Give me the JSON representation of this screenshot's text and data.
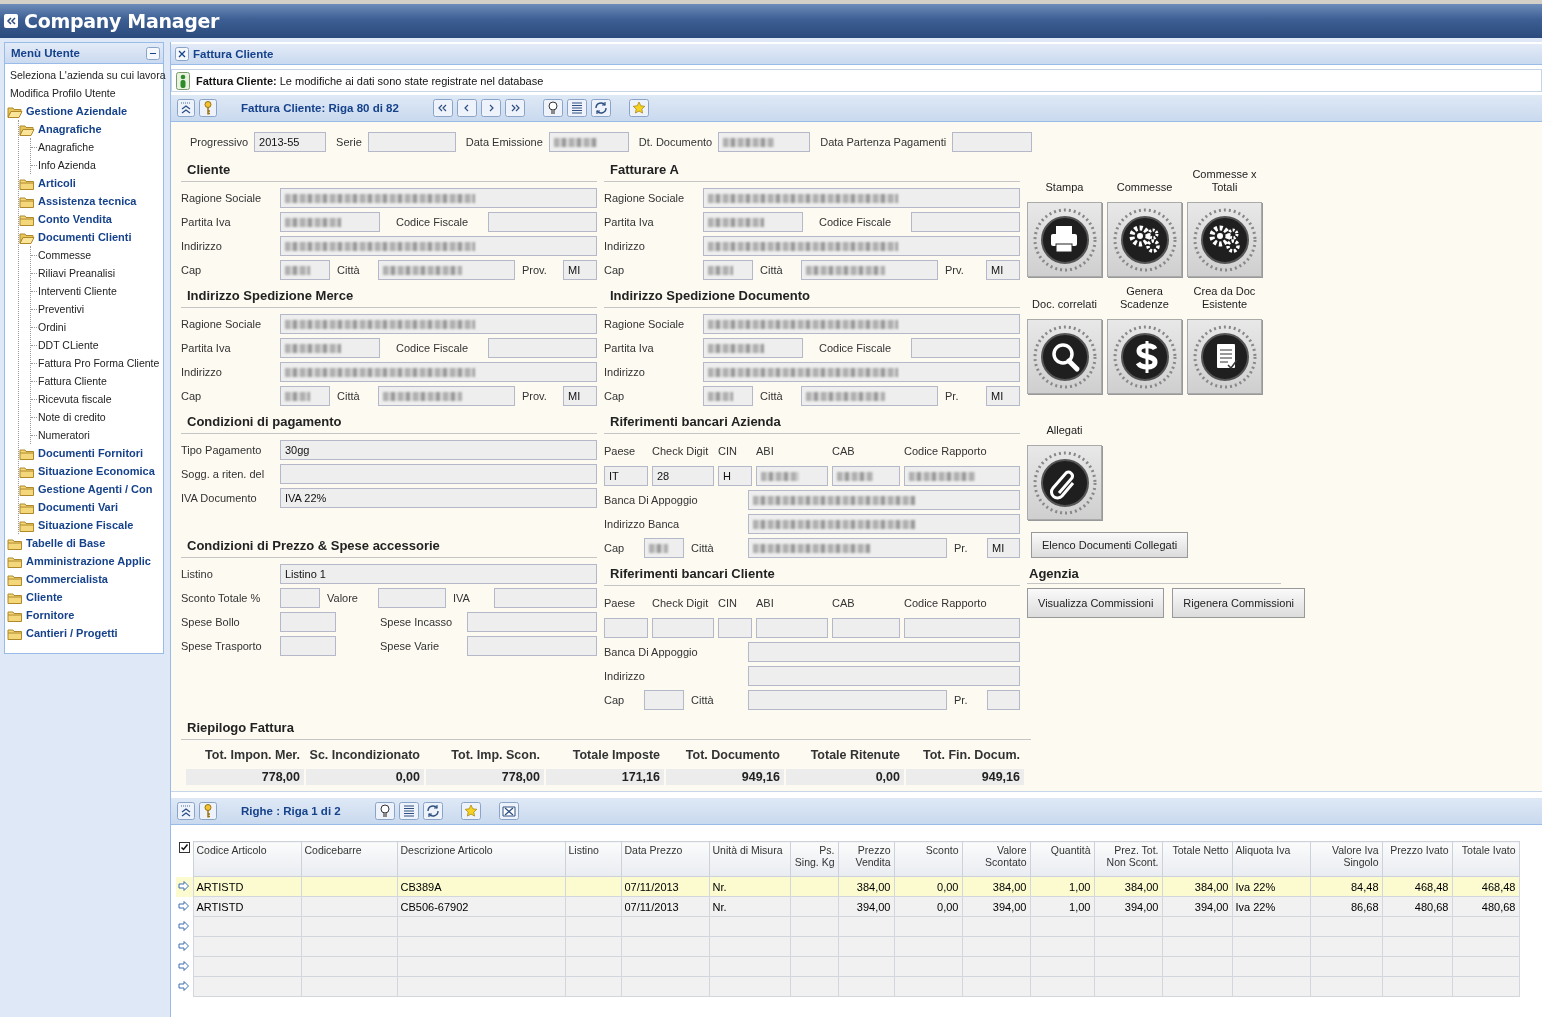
{
  "app_title": "Company Manager",
  "sidebar": {
    "title": "Menù Utente",
    "links": [
      "Seleziona L'azienda su cui lavora",
      "Modifica Profilo Utente"
    ],
    "tree": [
      {
        "label": "Gestione Aziendale",
        "expanded": true,
        "children": [
          {
            "label": "Anagrafiche",
            "expanded": true,
            "children": [
              {
                "label": "Anagrafiche"
              },
              {
                "label": "Info Azienda"
              }
            ]
          },
          {
            "label": "Articoli",
            "expanded": false
          },
          {
            "label": "Assistenza tecnica",
            "expanded": false
          },
          {
            "label": "Conto Vendita",
            "expanded": false
          },
          {
            "label": "Documenti Clienti",
            "expanded": true,
            "children": [
              {
                "label": "Commesse"
              },
              {
                "label": "Riliavi Preanalisi"
              },
              {
                "label": "Interventi Cliente"
              },
              {
                "label": "Preventivi"
              },
              {
                "label": "Ordini"
              },
              {
                "label": "DDT CLiente"
              },
              {
                "label": "Fattura Pro Forma Cliente"
              },
              {
                "label": "Fattura Cliente"
              },
              {
                "label": "Ricevuta fiscale"
              },
              {
                "label": "Note di credito"
              },
              {
                "label": "Numeratori"
              }
            ]
          },
          {
            "label": "Documenti Fornitori",
            "expanded": false
          },
          {
            "label": "Situazione Economica",
            "expanded": false
          },
          {
            "label": "Gestione Agenti / Con",
            "expanded": false
          },
          {
            "label": "Documenti Vari",
            "expanded": false
          },
          {
            "label": "Situazione Fiscale",
            "expanded": false
          }
        ]
      },
      {
        "label": "Tabelle di Base",
        "expanded": false
      },
      {
        "label": "Amministrazione Applic",
        "expanded": false
      },
      {
        "label": "Commercialista",
        "expanded": false
      },
      {
        "label": "Cliente",
        "expanded": false
      },
      {
        "label": "Fornitore",
        "expanded": false
      },
      {
        "label": "Cantieri / Progetti",
        "expanded": false
      }
    ]
  },
  "panel": {
    "title": "Fattura Cliente",
    "message": "**Fattura Cliente:** Le modifiche ai dati sono state registrate nel database",
    "toolbar": {
      "caption": "Fattura Cliente: Riga 80 di 82",
      "navigation": true,
      "export": false
    }
  },
  "form": {
    "header_fields": [
      {
        "label": "Progressivo",
        "value": "2013-55",
        "redacted": false
      },
      {
        "label": "Serie",
        "redacted": false
      },
      {
        "label": "Data Emissione",
        "redacted": true
      },
      {
        "label": "Dt. Documento",
        "redacted": true
      },
      {
        "label": "Data Partenza Pagamenti",
        "redacted": false
      }
    ],
    "left": [
      {
        "title": "Cliente",
        "kind": "address",
        "rows": [
          [
            {
              "kind": "label",
              "text": "Ragione Sociale"
            },
            {
              "kind": "field",
              "redacted": true
            }
          ],
          [
            {
              "kind": "label",
              "text": "Partita Iva"
            },
            {
              "kind": "field",
              "redacted": true
            },
            {
              "kind": "label",
              "text": "Codice Fiscale"
            },
            {
              "kind": "field",
              "redacted": false
            }
          ],
          [
            {
              "kind": "label",
              "text": "Indirizzo"
            },
            {
              "kind": "field",
              "redacted": true
            }
          ],
          [
            {
              "kind": "label",
              "text": "Cap"
            },
            {
              "kind": "field",
              "redacted": true
            },
            {
              "kind": "label",
              "text": "Città"
            },
            {
              "kind": "field",
              "redacted": true
            },
            {
              "kind": "label",
              "text": "Prov."
            },
            {
              "kind": "field",
              "redacted": false,
              "value": "MI"
            }
          ]
        ]
      },
      {
        "title": "Indirizzo Spedizione Merce",
        "kind": "address",
        "rows": [
          [
            {
              "kind": "label",
              "text": "Ragione Sociale"
            },
            {
              "kind": "field",
              "redacted": true
            }
          ],
          [
            {
              "kind": "label",
              "text": "Partita Iva"
            },
            {
              "kind": "field",
              "redacted": true
            },
            {
              "kind": "label",
              "text": "Codice Fiscale"
            },
            {
              "kind": "field",
              "redacted": false
            }
          ],
          [
            {
              "kind": "label",
              "text": "Indirizzo"
            },
            {
              "kind": "field",
              "redacted": true
            }
          ],
          [
            {
              "kind": "label",
              "text": "Cap"
            },
            {
              "kind": "field",
              "redacted": true
            },
            {
              "kind": "label",
              "text": "Città"
            },
            {
              "kind": "field",
              "redacted": true
            },
            {
              "kind": "label",
              "text": "Prov."
            },
            {
              "kind": "field",
              "redacted": false,
              "value": "MI"
            }
          ]
        ]
      },
      {
        "title": "Condizioni di pagamento",
        "kind": "plain",
        "rows": [
          [
            {
              "kind": "label",
              "text": "Tipo Pagamento"
            },
            {
              "kind": "field",
              "redacted": false,
              "value": "30gg"
            }
          ],
          [
            {
              "kind": "label",
              "text": "Sogg. a riten. del"
            },
            {
              "kind": "field",
              "redacted": false
            }
          ],
          [
            {
              "kind": "label",
              "text": "IVA Documento"
            },
            {
              "kind": "field",
              "redacted": false,
              "value": "IVA 22%"
            }
          ]
        ]
      },
      {
        "title": "Condizioni di Prezzo & Spese accessorie",
        "kind": "plain",
        "rows": [
          [
            {
              "kind": "label",
              "text": "Listino"
            },
            {
              "kind": "field",
              "redacted": false,
              "value": "Listino 1"
            }
          ],
          [
            {
              "kind": "label",
              "text": "Sconto Totale %"
            },
            {
              "kind": "field",
              "redacted": false
            },
            {
              "kind": "label",
              "text": "Valore"
            },
            {
              "kind": "field",
              "redacted": false
            },
            {
              "kind": "label",
              "text": "IVA"
            },
            {
              "kind": "field",
              "redacted": false
            }
          ],
          [
            {
              "kind": "label",
              "text": "Spese Bollo"
            },
            {
              "kind": "field",
              "redacted": false
            },
            {
              "kind": "label",
              "text": "Spese Incasso"
            },
            {
              "kind": "field",
              "redacted": false
            }
          ],
          [
            {
              "kind": "label",
              "text": "Spese Trasporto"
            },
            {
              "kind": "field",
              "redacted": false
            },
            {
              "kind": "label",
              "text": "Spese Varie"
            },
            {
              "kind": "field",
              "redacted": false
            }
          ]
        ]
      }
    ],
    "right": [
      {
        "title": "Fatturare A",
        "kind": "address",
        "rows": [
          [
            {
              "kind": "label",
              "text": "Ragione Sociale"
            },
            {
              "kind": "field",
              "redacted": true
            }
          ],
          [
            {
              "kind": "label",
              "text": "Partita Iva"
            },
            {
              "kind": "field",
              "redacted": true
            },
            {
              "kind": "label",
              "text": "Codice Fiscale"
            },
            {
              "kind": "field",
              "redacted": false
            }
          ],
          [
            {
              "kind": "label",
              "text": "Indirizzo"
            },
            {
              "kind": "field",
              "redacted": true
            }
          ],
          [
            {
              "kind": "label",
              "text": "Cap"
            },
            {
              "kind": "field",
              "redacted": true
            },
            {
              "kind": "label",
              "text": "Città"
            },
            {
              "kind": "field",
              "redacted": true
            },
            {
              "kind": "label",
              "text": "Prv."
            },
            {
              "kind": "field",
              "redacted": false,
              "value": "MI"
            }
          ]
        ]
      },
      {
        "title": "Indirizzo Spedizione Documento",
        "kind": "address",
        "rows": [
          [
            {
              "kind": "label",
              "text": "Ragione Sociale"
            },
            {
              "kind": "field",
              "redacted": true
            }
          ],
          [
            {
              "kind": "label",
              "text": "Partita Iva"
            },
            {
              "kind": "field",
              "redacted": true
            },
            {
              "kind": "label",
              "text": "Codice Fiscale"
            },
            {
              "kind": "field",
              "redacted": false
            }
          ],
          [
            {
              "kind": "label",
              "text": "Indirizzo"
            },
            {
              "kind": "field",
              "redacted": true
            }
          ],
          [
            {
              "kind": "label",
              "text": "Cap"
            },
            {
              "kind": "field",
              "redacted": true
            },
            {
              "kind": "label",
              "text": "Città"
            },
            {
              "kind": "field",
              "redacted": true
            },
            {
              "kind": "label",
              "text": "Pr."
            },
            {
              "kind": "field",
              "redacted": false,
              "value": "MI"
            }
          ]
        ]
      },
      {
        "title": "Riferimenti bancari Azienda",
        "kind": "bank",
        "code_labels": [
          "Paese",
          "Check Digit",
          "CIN",
          "ABI",
          "CAB",
          "Codice Rapporto"
        ],
        "code_fields": [
          {
            "value": "IT",
            "redacted": false
          },
          {
            "value": "28",
            "redacted": false
          },
          {
            "value": "H",
            "redacted": false
          },
          {
            "redacted": true
          },
          {
            "redacted": true
          },
          {
            "redacted": true
          }
        ],
        "rows": [
          [
            {
              "kind": "label",
              "text": "Banca Di Appoggio"
            },
            {
              "kind": "field",
              "redacted": true
            }
          ],
          [
            {
              "kind": "label",
              "text": "Indirizzo Banca"
            },
            {
              "kind": "field",
              "redacted": true
            }
          ],
          [
            {
              "kind": "label",
              "text": "Cap"
            },
            {
              "kind": "field",
              "redacted": true
            },
            {
              "kind": "label",
              "text": "Città"
            },
            {
              "kind": "field",
              "redacted": true
            },
            {
              "kind": "label",
              "text": "Pr."
            },
            {
              "kind": "field",
              "redacted": false,
              "value": "MI"
            }
          ]
        ]
      },
      {
        "title": "Riferimenti bancari Cliente",
        "kind": "bank",
        "code_labels": [
          "Paese",
          "Check Digit",
          "CIN",
          "ABI",
          "CAB",
          "Codice Rapporto"
        ],
        "code_fields": [
          {
            "redacted": false
          },
          {
            "redacted": false
          },
          {
            "redacted": false
          },
          {
            "redacted": false
          },
          {
            "redacted": false
          },
          {
            "redacted": false
          }
        ],
        "rows": [
          [
            {
              "kind": "label",
              "text": "Banca Di Appoggio"
            },
            {
              "kind": "field",
              "redacted": false
            }
          ],
          [
            {
              "kind": "label",
              "text": "Indirizzo"
            },
            {
              "kind": "field",
              "redacted": false
            }
          ],
          [
            {
              "kind": "label",
              "text": "Cap"
            },
            {
              "kind": "field",
              "redacted": false
            },
            {
              "kind": "label",
              "text": "Città"
            },
            {
              "kind": "field",
              "redacted": false
            },
            {
              "kind": "label",
              "text": "Pr."
            },
            {
              "kind": "field",
              "redacted": false
            }
          ]
        ]
      }
    ],
    "actions": {
      "buttons": [
        {
          "label": "Stampa"
        },
        {
          "label": "Commesse"
        },
        {
          "label": "Commesse x Totali"
        },
        {
          "label": "Doc. correlati"
        },
        {
          "label": "Genera Scadenze"
        },
        {
          "label": "Crea da Doc Esistente"
        },
        {
          "label": "Allegati"
        }
      ],
      "link_button": "Elenco Documenti Collegati",
      "agency": {
        "title": "Agenzia",
        "buttons": [
          "Visualizza Commissioni",
          "Rigenera Commissioni"
        ]
      }
    },
    "summary": {
      "title": "Riepilogo Fattura",
      "columns": [
        {
          "label": "Tot. Impon. Mer.",
          "value": "778,00"
        },
        {
          "label": "Sc. Incondizionato",
          "value": "0,00"
        },
        {
          "label": "Tot. Imp. Scon.",
          "value": "778,00"
        },
        {
          "label": "Totale Imposte",
          "value": "171,16"
        },
        {
          "label": "Tot. Documento",
          "value": "949,16"
        },
        {
          "label": "Totale Ritenute",
          "value": "0,00"
        },
        {
          "label": "Tot. Fin. Docum.",
          "value": "949,16"
        }
      ]
    }
  },
  "lines": {
    "toolbar": {
      "caption": "Righe : Riga 1 di 2",
      "navigation": false,
      "export": true
    },
    "header_checked": true,
    "columns": [
      {
        "label": "Codice Articolo",
        "kind": "text"
      },
      {
        "label": "Codicebarre",
        "kind": "text"
      },
      {
        "label": "Descrizione Articolo",
        "kind": "text"
      },
      {
        "label": "Listino",
        "kind": "text"
      },
      {
        "label": "Data Prezzo",
        "kind": "text"
      },
      {
        "label": "Unità di Misura",
        "kind": "text"
      },
      {
        "label": "Ps. Sing. Kg",
        "kind": "number"
      },
      {
        "label": "Prezzo Vendita",
        "kind": "number"
      },
      {
        "label": "Sconto",
        "kind": "number"
      },
      {
        "label": "Valore Scontato",
        "kind": "number"
      },
      {
        "label": "Quantità",
        "kind": "number"
      },
      {
        "label": "Prez. Tot. Non Scont.",
        "kind": "number"
      },
      {
        "label": "Totale Netto",
        "kind": "number"
      },
      {
        "label": "Aliquota Iva",
        "kind": "text"
      },
      {
        "label": "Valore Iva Singolo",
        "kind": "number"
      },
      {
        "label": "Prezzo Ivato",
        "kind": "number"
      },
      {
        "label": "Totale Ivato",
        "kind": "number"
      }
    ],
    "rows": [
      {
        "selected": true,
        "cells": [
          "ARTISTD",
          null,
          "CB389A",
          null,
          "07/11/2013",
          "Nr.",
          null,
          "384,00",
          "0,00",
          "384,00",
          "1,00",
          "384,00",
          "384,00",
          "Iva 22%",
          "84,48",
          "468,48",
          "468,48"
        ]
      },
      {
        "selected": false,
        "cells": [
          "ARTISTD",
          null,
          "CB506-67902",
          null,
          "07/11/2013",
          "Nr.",
          null,
          "394,00",
          "0,00",
          "394,00",
          "1,00",
          "394,00",
          "394,00",
          "Iva 22%",
          "86,68",
          "480,68",
          "480,68"
        ]
      }
    ]
  }
}
